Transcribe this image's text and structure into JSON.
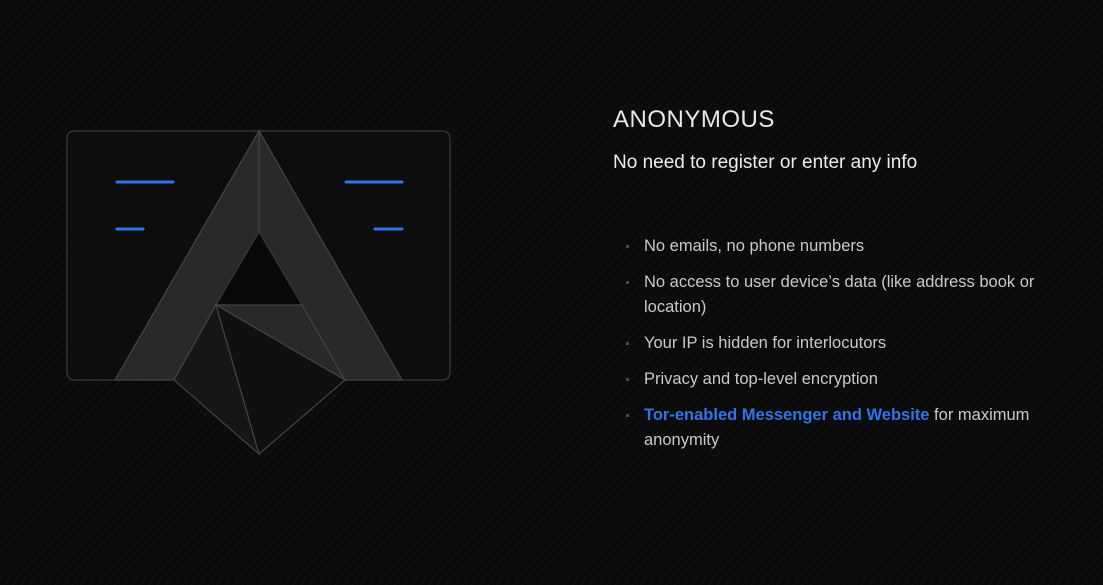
{
  "section": {
    "title": "ANONYMOUS",
    "subtitle": "No need to register or enter any info"
  },
  "features": [
    {
      "text": "No emails, no phone numbers"
    },
    {
      "text": "No access to user device’s data (like address book or location)"
    },
    {
      "text": "Your IP is hidden for interlocutors"
    },
    {
      "text": "Privacy and top-level encryption"
    },
    {
      "link": "Tor-enabled Messenger and Website",
      "text": " for maximum anonymity"
    }
  ],
  "colors": {
    "accent": "#2f74e8",
    "background": "#0b0b0c",
    "heading": "#e8e8e8",
    "body_text": "#c9c9c9"
  },
  "illustration": {
    "icon": "anonymous-mask-icon"
  }
}
